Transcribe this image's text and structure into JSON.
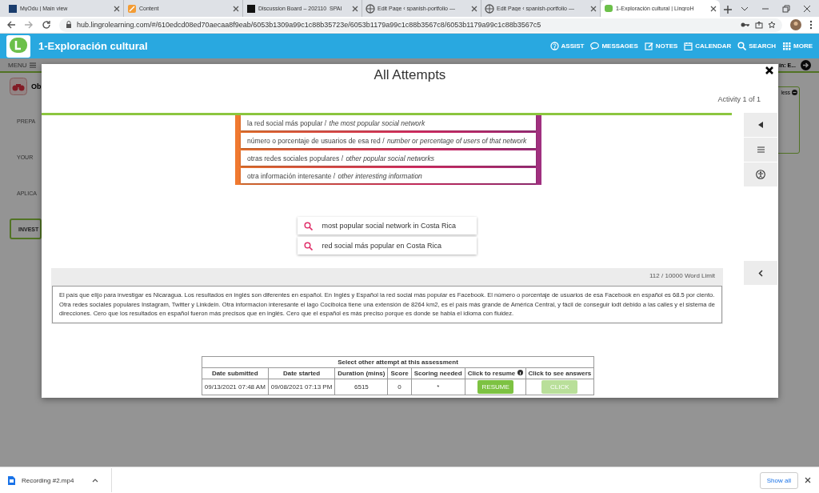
{
  "browser": {
    "tabs": [
      {
        "title": "MyOdu | Main view",
        "kind": "odu",
        "selected": false
      },
      {
        "title": "Content",
        "kind": "pencil",
        "selected": false
      },
      {
        "title": "Discussion Board – 202110_SPAI",
        "kind": "bb",
        "selected": false
      },
      {
        "title": "Edit Page ‹ spanish-portfolio —",
        "kind": "globe",
        "selected": false
      },
      {
        "title": "Edit Page ‹ spanish-portfolio —",
        "kind": "globe",
        "selected": false
      },
      {
        "title": "1-Exploración cultural | LingroH",
        "kind": "lingro",
        "selected": true
      }
    ],
    "url": "hub.lingrolearning.com/#/610edcd08ed70aecaa8f9eab/6053b1309a99c1c88b35723e/6053b1179a99c1c88b3567c8/6053b1179a99c1c88b3567c5"
  },
  "app_header": {
    "title": "1-Exploración cultural",
    "nav": [
      {
        "label": "ASSIST",
        "kind": "help"
      },
      {
        "label": "MESSAGES",
        "kind": "chat"
      },
      {
        "label": "NOTES",
        "kind": "note"
      },
      {
        "label": "CALENDAR",
        "kind": "calendar"
      },
      {
        "label": "SEARCH",
        "kind": "search"
      },
      {
        "label": "MORE",
        "kind": "grid"
      }
    ]
  },
  "sub_bar": {
    "menu": "MENU",
    "next": "ín: E..."
  },
  "sidebar": {
    "header": "Ob",
    "items": [
      {
        "label": "PREPA",
        "selected": false
      },
      {
        "label": "YOUR",
        "selected": false
      },
      {
        "label": "APLICA",
        "selected": false
      },
      {
        "label": "INVEST",
        "selected": true
      }
    ],
    "card_label": "less"
  },
  "modal": {
    "title": "All Attempts",
    "activity": "Activity 1 of 1",
    "outline": [
      {
        "term": "la red social más popular /",
        "translation": "the most popular social network"
      },
      {
        "term": "número o porcentaje de usuarios de esa red /",
        "translation": "number or percentage of users of that network"
      },
      {
        "term": "otras redes sociales populares /",
        "translation": "other popular social networks"
      },
      {
        "term": "otra información interesante /",
        "translation": "other interesting information"
      }
    ],
    "searches": [
      "most popular social network in Costa Rica",
      "red social más popular en Costa Rica"
    ],
    "essay": {
      "word_limit": "112 /  10000 Word Limit",
      "text": " El país que elijo para investigar es Nicaragua. Los resultados en inglés son diferentes en español. En Inglés y Español la red social más popular es Facebook. El número o porcentaje de usuarios de esa Facebook en español es 68.5 por ciento. Otra redes sociales populares Instagram, Twitter y Linkdein.   Otra informacion interesante el lago Cocibolca tiene una extensión de 8264 km2, es el país más grande de América Central, y fácil de conseguir lodt debido a las calles y el sistema de direcciones. Cero que los resultados en español fueron más precisos que en inglés. Cero que el español es más preciso porque es donde se habla el idioma con fluidez."
    },
    "attempts": {
      "caption": "Select other attempt at this assessment",
      "columns": [
        "Date submitted",
        "Date started",
        "Duration (mins)",
        "Score",
        "Scoring needed",
        "Click to  resume",
        "Click to see answers"
      ],
      "rows": [
        {
          "cells": [
            "09/13/2021 07:48 AM",
            "09/08/2021 07:13 PM",
            "6515",
            "0",
            "*"
          ],
          "resume": {
            "label": "RESUME",
            "disabled": false
          },
          "answers": {
            "label": "CLICK",
            "disabled": true
          }
        }
      ]
    }
  },
  "downloads": {
    "file": "Recording #2.mp4",
    "show_all": "Show all"
  }
}
